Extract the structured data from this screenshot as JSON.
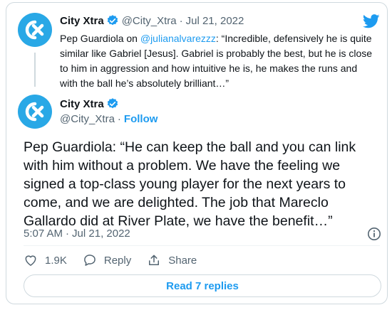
{
  "quoted": {
    "name": "City Xtra",
    "handle": "@City_Xtra",
    "separator": "·",
    "date": "Jul 21, 2022",
    "text_prefix": "Pep Guardiola on ",
    "mention": "@julianalvarezzz",
    "text_suffix": ": “Incredible, defensively he is quite similar like Gabriel [Jesus]. Gabriel is probably the best, but he is close to him in aggression and how intuitive he is, he makes the runs and with the ball he’s absolutely brilliant…”"
  },
  "main": {
    "name": "City Xtra",
    "handle": "@City_Xtra",
    "separator": "·",
    "follow_label": "Follow",
    "text": "Pep Guardiola: “He can keep the ball and you can link with him without a problem. We have the feeling we signed a top-class young player for the next years to come, and we are delighted. The job that Mareclo Gallardo did at River Plate, we have the benefit…”",
    "time": "5:07 AM",
    "date": "Jul 21, 2022"
  },
  "actions": {
    "likes": "1.9K",
    "reply_label": "Reply",
    "share_label": "Share"
  },
  "read_replies_label": "Read 7 replies",
  "icons": {
    "avatar": "city-xtra-logo",
    "verified": "verified-badge-icon",
    "brand": "twitter-bird-icon",
    "info": "info-icon",
    "like": "heart-icon",
    "reply": "speech-bubble-icon",
    "share": "share-upload-icon"
  },
  "colors": {
    "accent": "#1d9bf0",
    "avatar_bg": "#29a8e6",
    "text": "#0f1419",
    "muted": "#536471",
    "border": "#cfd9de"
  }
}
